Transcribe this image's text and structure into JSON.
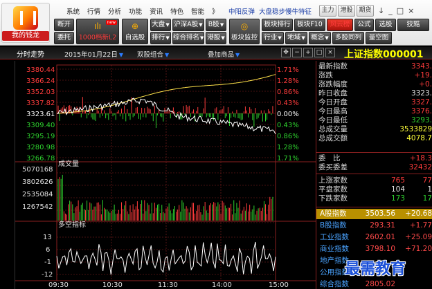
{
  "logo": {
    "label": "我的钱龙"
  },
  "menu": [
    "系统",
    "行情",
    "分析",
    "功能",
    "资讯",
    "特色",
    "智能",
    "》"
  ],
  "links": [
    "中阳反弹",
    "大盘稳步慢牛特征"
  ],
  "tabs": [
    "主力",
    "港股",
    "期货"
  ],
  "window_buttons": [
    "↓",
    "_",
    "□",
    "×"
  ],
  "toolbar": {
    "row1": {
      "duankai": "断开",
      "l2": "1000档新L2",
      "new_badge": "new",
      "dapan": "大盘",
      "hushi": "沪深A股",
      "bgu": "B股",
      "bankuai": "板块排行",
      "bankuai_f10": "板块F10",
      "fengyun": "风云榜",
      "gongshi": "公式",
      "xuangu": "选股",
      "liaoliao": "狡黠"
    },
    "row2": {
      "weituo": "委托",
      "zixuan": "自选股",
      "paihang": "排行",
      "zonghe": "综合排名",
      "ganggu": "港股",
      "jiankong": "板块监控",
      "hangye": "行业",
      "diyu": "地域",
      "gainian": "概念",
      "duogu": "多股同列",
      "liangkong": "量空图"
    }
  },
  "chart_header": {
    "period": "分时走势",
    "date": "2015年01月22日",
    "dropdown1": "双股组合",
    "dropdown2": "叠加商品",
    "index_title": "上证指数000001"
  },
  "price_axis": {
    "left": [
      "3380.44",
      "3366.24",
      "3352.03",
      "3337.82",
      "3323.61",
      "3309.40",
      "3295.19",
      "3280.98",
      "3266.78"
    ],
    "right": [
      "1.71%",
      "1.28%",
      "0.86%",
      "0.43%",
      "0.00%",
      "0.43%",
      "0.86%",
      "1.28%",
      "1.71%"
    ]
  },
  "volume_axis": {
    "title": "成交量",
    "labels": [
      "5070168",
      "3802626",
      "2535084",
      "1267542"
    ]
  },
  "indicator": {
    "title": "多空指标",
    "labels": [
      "13",
      "6",
      "-1",
      "-12"
    ]
  },
  "time_axis": [
    "09:30",
    "10:30",
    "11:30",
    "14:00",
    "15:00"
  ],
  "quote_panel": {
    "rows": [
      {
        "label": "最新指数",
        "value": "3343.",
        "cls": "red"
      },
      {
        "label": "涨跌",
        "value": "+19.",
        "cls": "red"
      },
      {
        "label": "涨跌幅度",
        "value": "+0.",
        "cls": "red"
      },
      {
        "label": "昨日收盘",
        "value": "3323.",
        "cls": "white"
      },
      {
        "label": "今日开盘",
        "value": "3327.",
        "cls": "red"
      },
      {
        "label": "今日最高",
        "value": "3376.",
        "cls": "red"
      },
      {
        "label": "今日最低",
        "value": "3293.",
        "cls": "green"
      },
      {
        "label": "总成交量",
        "value": "3533829",
        "cls": "yellow"
      },
      {
        "label": "总成交额",
        "value": "4078.7",
        "cls": "yellow"
      }
    ],
    "rows2": [
      {
        "label": "委　比",
        "value": "+18.3",
        "cls": "red"
      },
      {
        "label": "委买委差",
        "value": "32432",
        "cls": "red"
      }
    ],
    "rows3": [
      {
        "label": "上涨家数",
        "mid": "765",
        "mid_cls": "red",
        "value": "77",
        "cls": "red"
      },
      {
        "label": "平盘家数",
        "mid": "104",
        "mid_cls": "white",
        "value": "1",
        "cls": "white"
      },
      {
        "label": "下跌家数",
        "mid": "173",
        "mid_cls": "green",
        "value": "17",
        "cls": "green"
      }
    ],
    "index_rows": [
      {
        "label": "A股指数",
        "mid": "3503.56",
        "chg": "+20.68"
      },
      {
        "label": "B股指数",
        "mid": "293.31",
        "chg": "+1.77"
      },
      {
        "label": "工业指数",
        "mid": "2602.01",
        "chg": "+25.09"
      },
      {
        "label": "商业指数",
        "mid": "3798.10",
        "chg": "+71.20"
      },
      {
        "label": "地产指数",
        "mid": "",
        "chg": ""
      },
      {
        "label": "公用指数",
        "mid": "",
        "chg": ""
      },
      {
        "label": "综合指数",
        "mid": "2805.02",
        "chg": ""
      }
    ]
  },
  "watermark": "最需教育",
  "colors": {
    "up": "#ff3c3c",
    "down": "#2ed12e",
    "price_line": "#ffffff",
    "avg_line": "#ffe24a",
    "grid": "#8c2020"
  }
}
